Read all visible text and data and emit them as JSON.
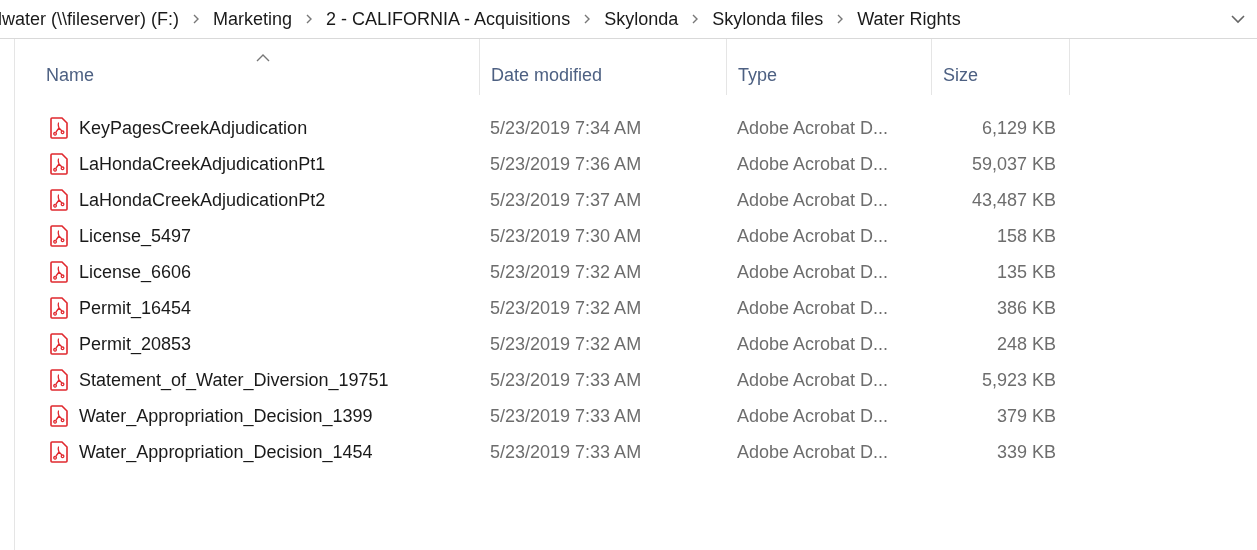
{
  "address_bar": {
    "crumbs": [
      "lwater (\\\\fileserver) (F:)",
      "Marketing",
      "2 - CALIFORNIA - Acquisitions",
      "Skylonda",
      "Skylonda files",
      "Water Rights"
    ]
  },
  "columns": [
    {
      "label": "Name",
      "sorted": true
    },
    {
      "label": "Date modified",
      "sorted": false
    },
    {
      "label": "Type",
      "sorted": false
    },
    {
      "label": "Size",
      "sorted": false
    }
  ],
  "files": [
    {
      "name": "KeyPagesCreekAdjudication",
      "date": "5/23/2019 7:34 AM",
      "type": "Adobe Acrobat D...",
      "size": "6,129 KB"
    },
    {
      "name": "LaHondaCreekAdjudicationPt1",
      "date": "5/23/2019 7:36 AM",
      "type": "Adobe Acrobat D...",
      "size": "59,037 KB"
    },
    {
      "name": "LaHondaCreekAdjudicationPt2",
      "date": "5/23/2019 7:37 AM",
      "type": "Adobe Acrobat D...",
      "size": "43,487 KB"
    },
    {
      "name": "License_5497",
      "date": "5/23/2019 7:30 AM",
      "type": "Adobe Acrobat D...",
      "size": "158 KB"
    },
    {
      "name": "License_6606",
      "date": "5/23/2019 7:32 AM",
      "type": "Adobe Acrobat D...",
      "size": "135 KB"
    },
    {
      "name": "Permit_16454",
      "date": "5/23/2019 7:32 AM",
      "type": "Adobe Acrobat D...",
      "size": "386 KB"
    },
    {
      "name": "Permit_20853",
      "date": "5/23/2019 7:32 AM",
      "type": "Adobe Acrobat D...",
      "size": "248 KB"
    },
    {
      "name": "Statement_of_Water_Diversion_19751",
      "date": "5/23/2019 7:33 AM",
      "type": "Adobe Acrobat D...",
      "size": "5,923 KB"
    },
    {
      "name": "Water_Appropriation_Decision_1399",
      "date": "5/23/2019 7:33 AM",
      "type": "Adobe Acrobat D...",
      "size": "379 KB"
    },
    {
      "name": "Water_Appropriation_Decision_1454",
      "date": "5/23/2019 7:33 AM",
      "type": "Adobe Acrobat D...",
      "size": "339 KB"
    }
  ]
}
